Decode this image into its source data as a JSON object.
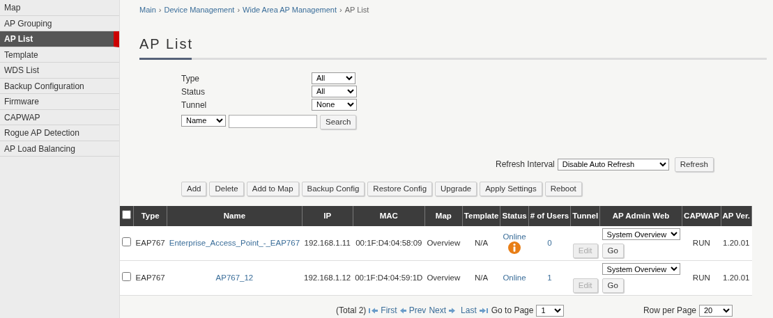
{
  "sidebar": {
    "items": [
      {
        "label": "Map",
        "selected": false
      },
      {
        "label": "AP Grouping",
        "selected": false
      },
      {
        "label": "AP List",
        "selected": true
      },
      {
        "label": "Template",
        "selected": false
      },
      {
        "label": "WDS List",
        "selected": false
      },
      {
        "label": "Backup Configuration",
        "selected": false
      },
      {
        "label": "Firmware",
        "selected": false
      },
      {
        "label": "CAPWAP",
        "selected": false
      },
      {
        "label": "Rogue AP Detection",
        "selected": false
      },
      {
        "label": "AP Load Balancing",
        "selected": false
      }
    ]
  },
  "breadcrumb": [
    {
      "kind": "link",
      "text": "Main"
    },
    {
      "kind": "separator",
      "text": "›"
    },
    {
      "kind": "link",
      "text": "Device Management"
    },
    {
      "kind": "separator",
      "text": "›"
    },
    {
      "kind": "link",
      "text": "Wide Area AP Management"
    },
    {
      "kind": "separator",
      "text": "›"
    },
    {
      "kind": "current",
      "text": "AP List"
    }
  ],
  "title": "AP List",
  "filters": [
    {
      "label": "Type",
      "value": "All"
    },
    {
      "label": "Status",
      "value": "All"
    },
    {
      "label": "Tunnel",
      "value": "None"
    }
  ],
  "search": {
    "field": "Name",
    "button": "Search"
  },
  "refresh": {
    "label": "Refresh Interval",
    "value": "Disable Auto Refresh",
    "button": "Refresh"
  },
  "actions": [
    "Add",
    "Delete",
    "Add to Map",
    "Backup Config",
    "Restore Config",
    "Upgrade",
    "Apply Settings",
    "Reboot"
  ],
  "table": {
    "select_all_checked": false,
    "columns": [
      "Type",
      "Name",
      "IP",
      "MAC",
      "Map",
      "Template",
      "Status",
      "# of Users",
      "Tunnel",
      "AP Admin Web",
      "CAPWAP",
      "AP Ver."
    ],
    "rows": [
      {
        "checked": false,
        "type": "EAP767",
        "name": "Enterprise_Access_Point_-_EAP767",
        "ip": "192.168.1.11",
        "mac": "00:1F:D4:04:58:09",
        "map": "Overview",
        "template": "N/A",
        "status": "Online",
        "alert": true,
        "users": "0",
        "tunnel_button": "Edit",
        "tunnel_disabled": true,
        "admin_web": "System Overview",
        "go": "Go",
        "capwap": "RUN",
        "version": "1.20.01"
      },
      {
        "checked": false,
        "type": "EAP767",
        "name": "AP767_12",
        "ip": "192.168.1.12",
        "mac": "00:1F:D4:04:59:1D",
        "map": "Overview",
        "template": "N/A",
        "status": "Online",
        "alert": false,
        "users": "1",
        "tunnel_button": "Edit",
        "tunnel_disabled": true,
        "admin_web": "System Overview",
        "go": "Go",
        "capwap": "RUN",
        "version": "1.20.01"
      }
    ]
  },
  "pager": {
    "total": "(Total 2)",
    "first": "First",
    "prev": "Prev",
    "next": "Next",
    "last": "Last",
    "goto_label": "Go to Page",
    "page": "1",
    "rows_label": "Row per Page",
    "rows_value": "20"
  }
}
